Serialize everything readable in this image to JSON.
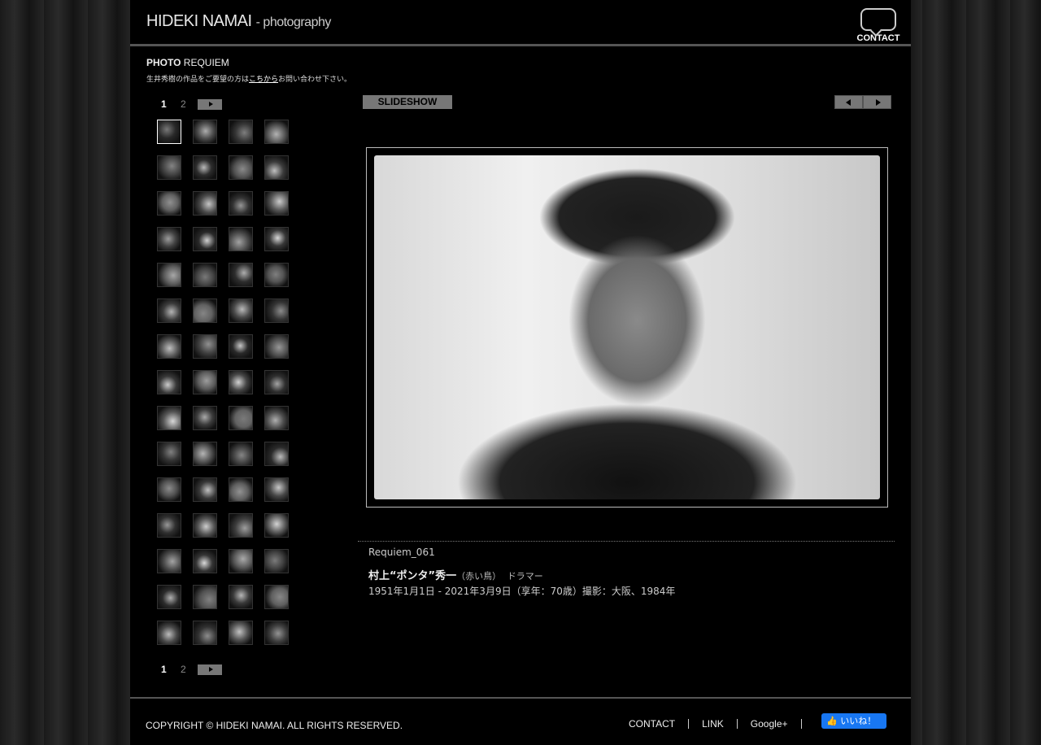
{
  "header": {
    "logo_main": "HIDEKI NAMAI",
    "logo_sub": "- photography",
    "contact_label": "CONTACT"
  },
  "section": {
    "title_bold": "PHOTO",
    "title_rest": "REQUIEM",
    "note_before": "生井秀樹の作品をご要望の方は",
    "note_link": "こちから",
    "note_after": "お問い合わせ下さい。"
  },
  "pager": {
    "current": "1",
    "other": "2"
  },
  "viewer": {
    "slideshow_label": "SLIDESHOW"
  },
  "caption": {
    "id": "Requiem_061",
    "name": "村上“ポンタ”秀一",
    "group": "（赤い鳥）",
    "role": "ドラマー",
    "dates": "1951年1月1日 - 2021年3月9日（享年：70歳）撮影：大阪、1984年"
  },
  "footer": {
    "copyright": "COPYRIGHT © HIDEKI NAMAI. ALL RIGHTS RESERVED.",
    "links": [
      "CONTACT",
      "LINK",
      "Google+"
    ],
    "like_label": "いいね！",
    "like_color": "#1877f2"
  }
}
